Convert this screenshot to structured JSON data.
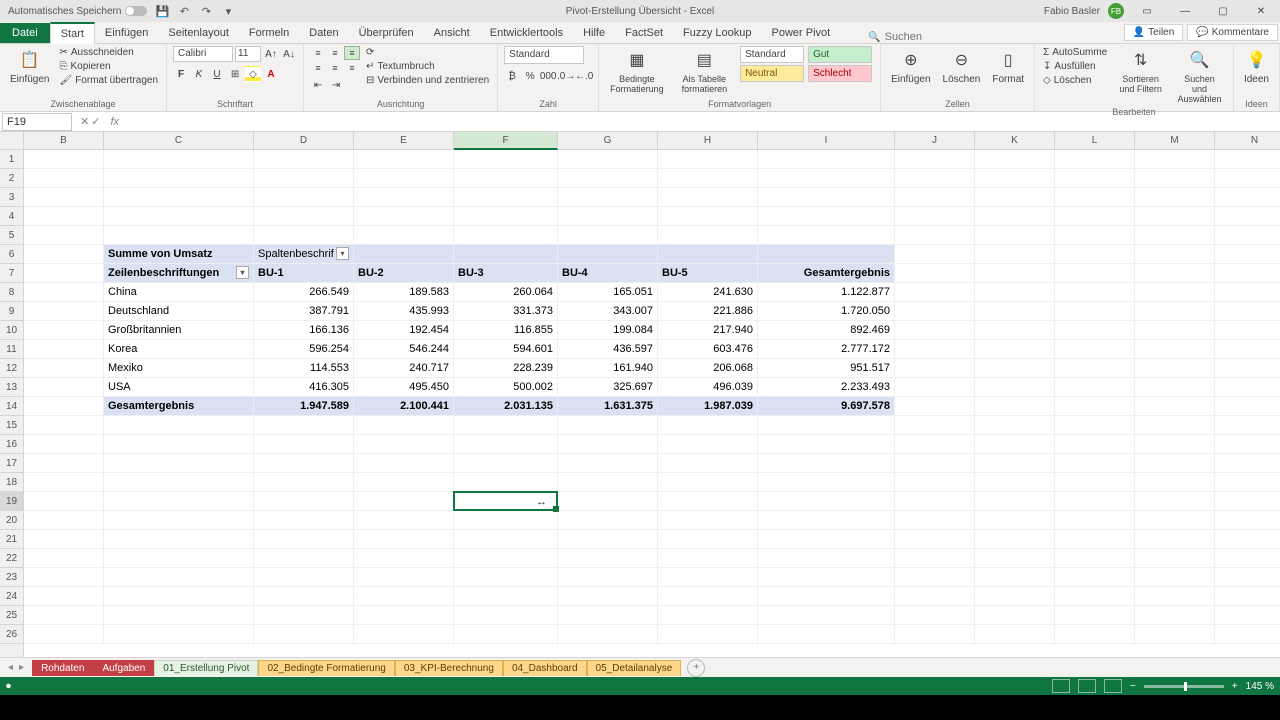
{
  "titlebar": {
    "autosave": "Automatisches Speichern",
    "title": "Pivot-Erstellung Übersicht - Excel",
    "user": "Fabio Basler",
    "user_initials": "FB"
  },
  "ribbon_tabs": {
    "file": "Datei",
    "start": "Start",
    "einfuegen": "Einfügen",
    "seitenlayout": "Seitenlayout",
    "formeln": "Formeln",
    "daten": "Daten",
    "ueberpruefen": "Überprüfen",
    "ansicht": "Ansicht",
    "entwicklertools": "Entwicklertools",
    "hilfe": "Hilfe",
    "factset": "FactSet",
    "fuzzy": "Fuzzy Lookup",
    "powerpivot": "Power Pivot",
    "search_placeholder": "Suchen",
    "teilen": "Teilen",
    "kommentare": "Kommentare"
  },
  "ribbon": {
    "clipboard": {
      "einfuegen": "Einfügen",
      "ausschneiden": "Ausschneiden",
      "kopieren": "Kopieren",
      "format": "Format übertragen",
      "label": "Zwischenablage"
    },
    "font": {
      "name": "Calibri",
      "size": "11",
      "label": "Schriftart"
    },
    "align": {
      "textumbruch": "Textumbruch",
      "verbinden": "Verbinden und zentrieren",
      "label": "Ausrichtung"
    },
    "number": {
      "format": "Standard",
      "label": "Zahl"
    },
    "styles": {
      "bedingte": "Bedingte Formatierung",
      "alstabelle": "Als Tabelle formatieren",
      "standard": "Standard",
      "gut": "Gut",
      "neutral": "Neutral",
      "schlecht": "Schlecht",
      "label": "Formatvorlagen"
    },
    "cells": {
      "einfuegen": "Einfügen",
      "loeschen": "Löschen",
      "format": "Format",
      "label": "Zellen"
    },
    "editing": {
      "autosumme": "AutoSumme",
      "ausfuellen": "Ausfüllen",
      "loeschen": "Löschen",
      "sortieren": "Sortieren und Filtern",
      "suchen": "Suchen und Auswählen",
      "label": "Bearbeiten"
    },
    "ideas": {
      "ideen": "Ideen",
      "label": "Ideen"
    }
  },
  "cell_ref": "F19",
  "columns": [
    "B",
    "C",
    "D",
    "E",
    "F",
    "G",
    "H",
    "I",
    "J",
    "K",
    "L",
    "M",
    "N"
  ],
  "row_count": 26,
  "chart_data": {
    "type": "table",
    "title": "Summe von Umsatz",
    "col_header_label": "Spaltenbeschrif",
    "row_header_label": "Zeilenbeschriftungen",
    "col_headers": [
      "BU-1",
      "BU-2",
      "BU-3",
      "BU-4",
      "BU-5",
      "Gesamtergebnis"
    ],
    "rows": [
      {
        "label": "China",
        "v": [
          "266.549",
          "189.583",
          "260.064",
          "165.051",
          "241.630",
          "1.122.877"
        ]
      },
      {
        "label": "Deutschland",
        "v": [
          "387.791",
          "435.993",
          "331.373",
          "343.007",
          "221.886",
          "1.720.050"
        ]
      },
      {
        "label": "Großbritannien",
        "v": [
          "166.136",
          "192.454",
          "116.855",
          "199.084",
          "217.940",
          "892.469"
        ]
      },
      {
        "label": "Korea",
        "v": [
          "596.254",
          "546.244",
          "594.601",
          "436.597",
          "603.476",
          "2.777.172"
        ]
      },
      {
        "label": "Mexiko",
        "v": [
          "114.553",
          "240.717",
          "228.239",
          "161.940",
          "206.068",
          "951.517"
        ]
      },
      {
        "label": "USA",
        "v": [
          "416.305",
          "495.450",
          "500.002",
          "325.697",
          "496.039",
          "2.233.493"
        ]
      }
    ],
    "total": {
      "label": "Gesamtergebnis",
      "v": [
        "1.947.589",
        "2.100.441",
        "2.031.135",
        "1.631.375",
        "1.987.039",
        "9.697.578"
      ]
    }
  },
  "sheet_tabs": {
    "rohdaten": "Rohdaten",
    "aufgaben": "Aufgaben",
    "t1": "01_Erstellung Pivot",
    "t2": "02_Bedingte Formatierung",
    "t3": "03_KPI-Berechnung",
    "t4": "04_Dashboard",
    "t5": "05_Detailanalyse"
  },
  "zoom": "145 %"
}
